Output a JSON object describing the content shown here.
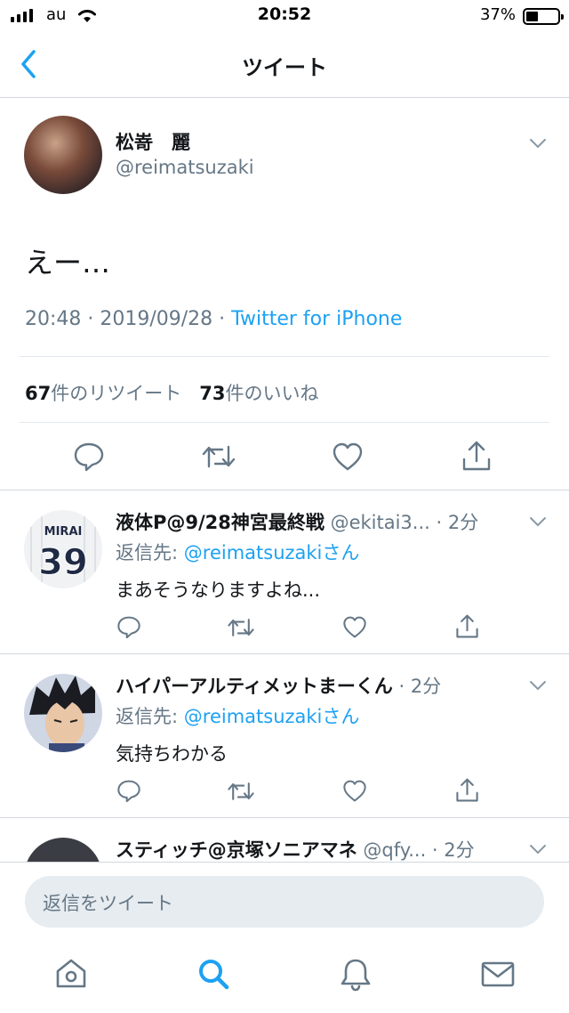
{
  "status_bar": {
    "carrier": "au",
    "time": "20:52",
    "battery_percent": "37%",
    "battery_level": 0.37
  },
  "nav": {
    "title": "ツイート",
    "back_icon": "chevron-left-icon"
  },
  "tweet": {
    "display_name": "松嵜　麗",
    "handle": "@reimatsuzaki",
    "text": "えー…",
    "timestamp": "20:48 · 2019/09/28 · ",
    "source": "Twitter for iPhone",
    "retweet_count": "67",
    "retweet_label": "件のリツイート",
    "like_count": "73",
    "like_label": "件のいいね"
  },
  "replies": [
    {
      "display_name": "液体P@9/28神宮最終戦",
      "handle": " @ekitai3... · 2分",
      "reply_prefix": "返信先: ",
      "reply_to": "@reimatsuzakiさん",
      "text": "まあそうなりますよね..."
    },
    {
      "display_name": "ハイパーアルティメットまーくん",
      "handle": " · 2分",
      "reply_prefix": "返信先: ",
      "reply_to": "@reimatsuzakiさん",
      "text": "気持ちわかる"
    },
    {
      "display_name": "スティッチ@京塚ソニアマネ",
      "handle": " @qfy... · 2分",
      "reply_prefix": "",
      "reply_to": "",
      "text": ""
    }
  ],
  "avatar_2_jersey": {
    "text": "MIRAI",
    "number": "39"
  },
  "compose": {
    "placeholder": "返信をツイート"
  },
  "tab_bar": [
    "home-icon",
    "search-icon",
    "notifications-bell-icon",
    "messages-envelope-icon"
  ],
  "colors": {
    "accent": "#1da1f2",
    "secondary_text": "#657786",
    "divider": "#e1e8ed",
    "compose_bg": "#e6ecf0"
  }
}
